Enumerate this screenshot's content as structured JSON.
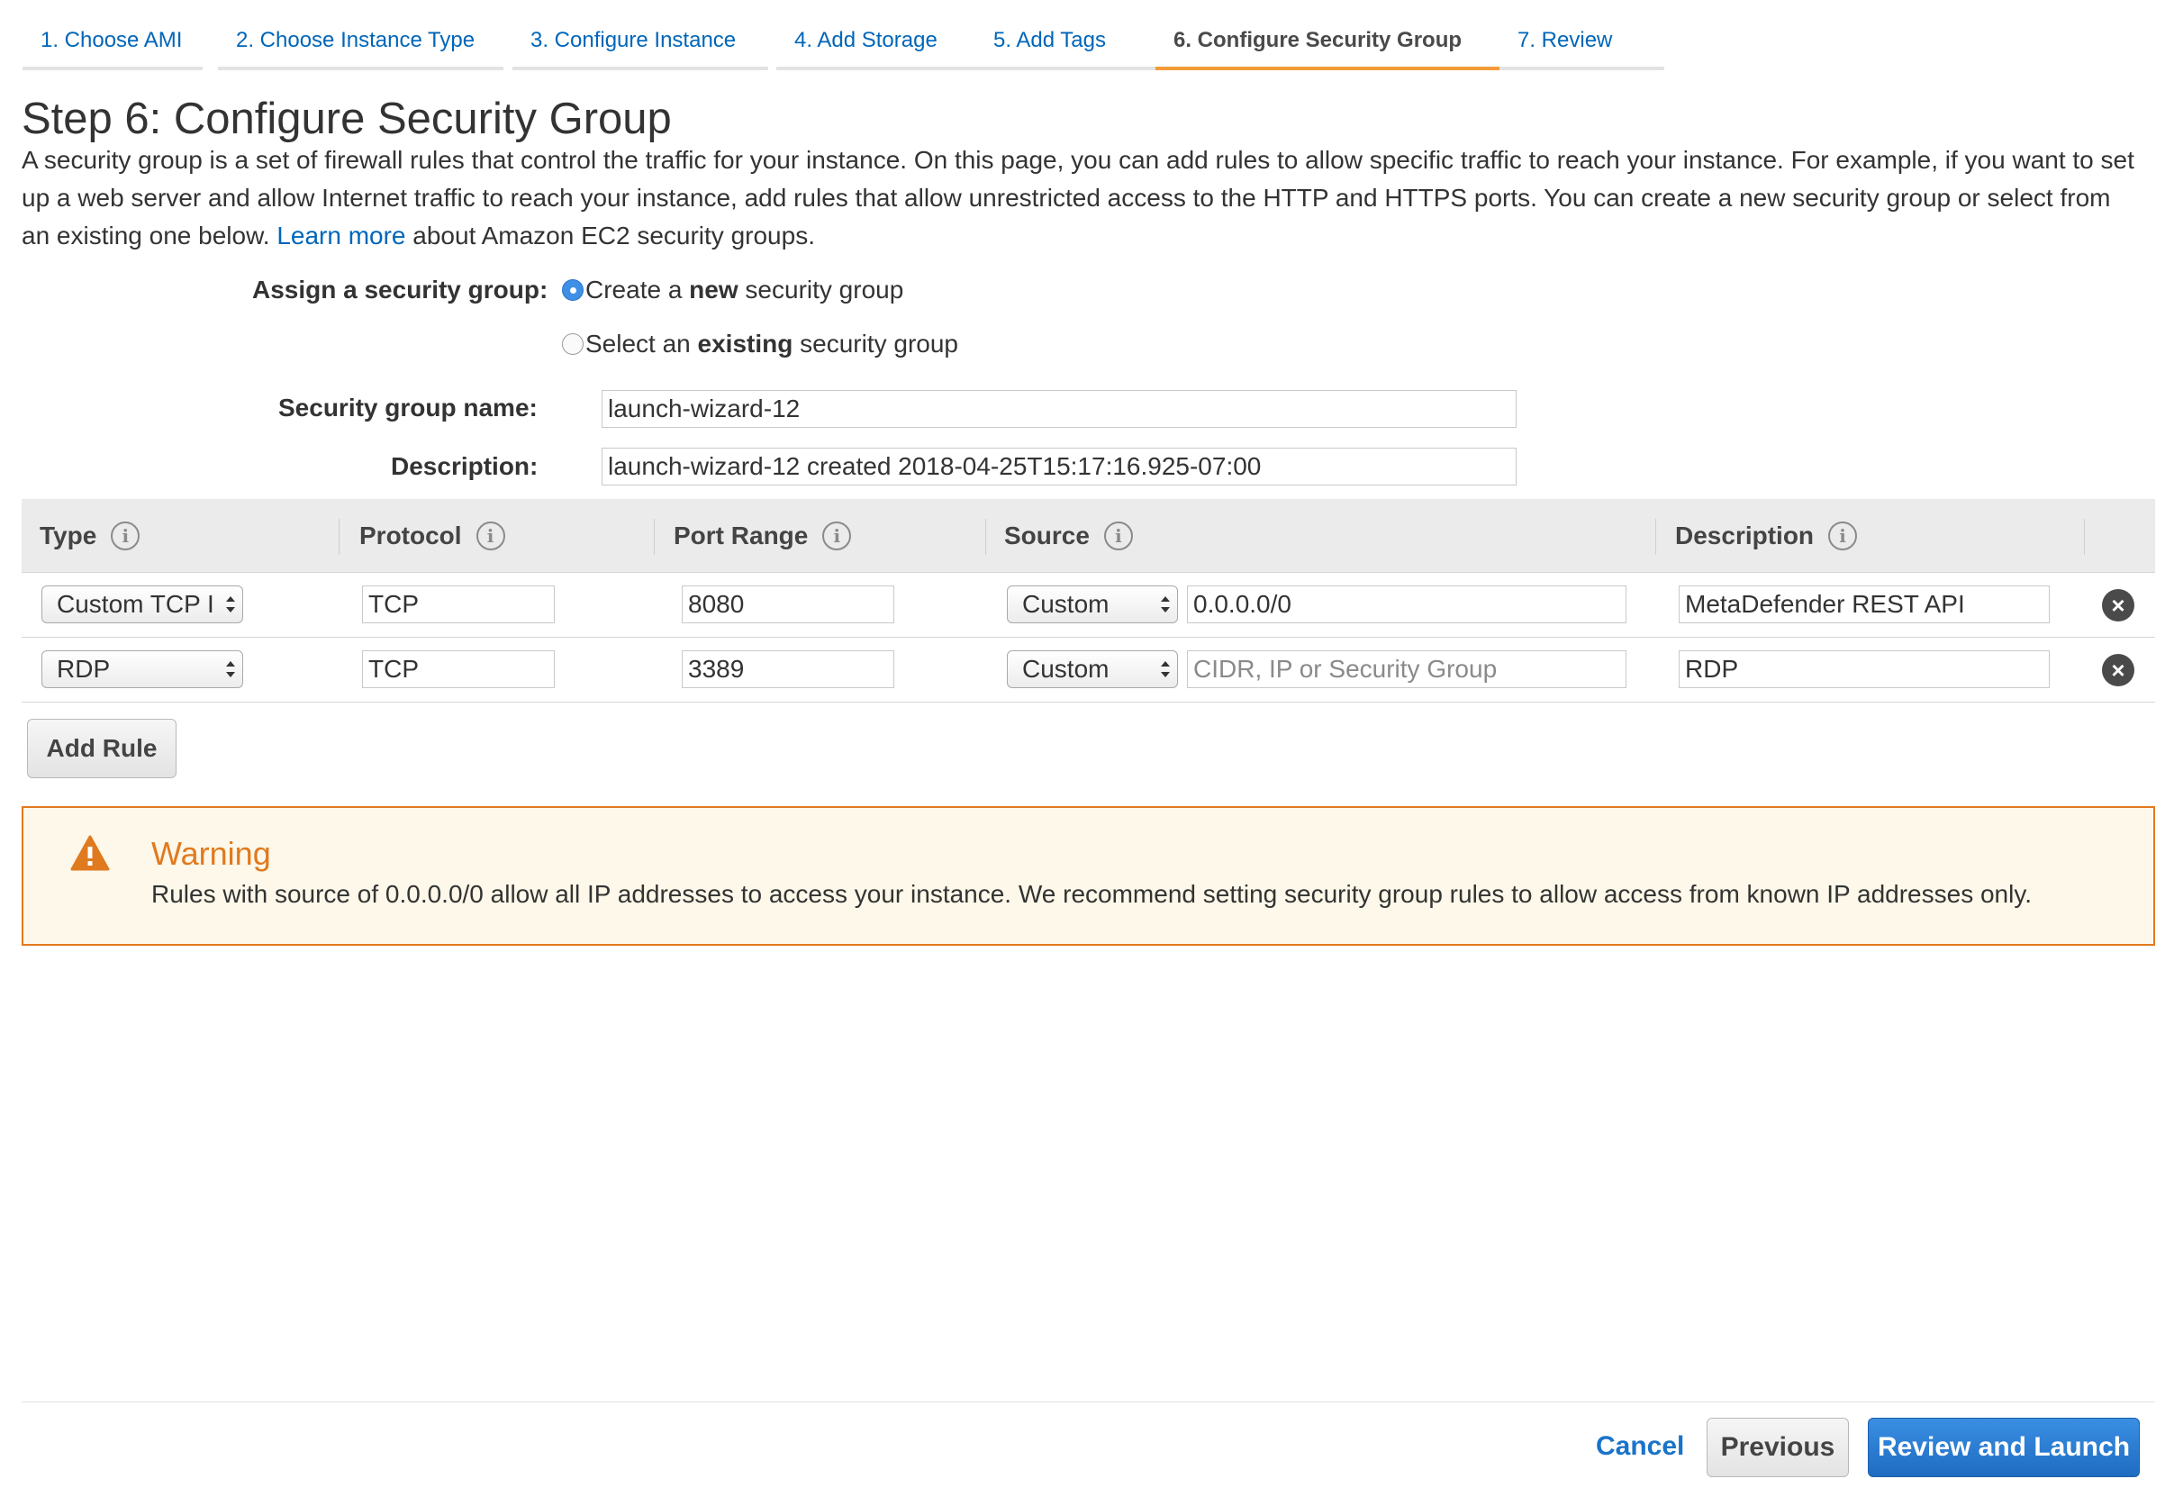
{
  "tabs": [
    {
      "label": "1. Choose AMI"
    },
    {
      "label": "2. Choose Instance Type"
    },
    {
      "label": "3. Configure Instance"
    },
    {
      "label": "4. Add Storage"
    },
    {
      "label": "5. Add Tags"
    },
    {
      "label": "6. Configure Security Group",
      "active": true
    },
    {
      "label": "7. Review"
    }
  ],
  "page": {
    "title": "Step 6: Configure Security Group",
    "intro_before_link": "A security group is a set of firewall rules that control the traffic for your instance. On this page, you can add rules to allow specific traffic to reach your instance. For example, if you want to set up a web server and allow Internet traffic to reach your instance, add rules that allow unrestricted access to the HTTP and HTTPS ports. You can create a new security group or select from an existing one below.",
    "learn_more": "Learn more",
    "intro_after_link": "about Amazon EC2 security groups."
  },
  "assign": {
    "label": "Assign a security group:",
    "option_new_prefix": "Create a ",
    "option_new_bold": "new",
    "option_new_suffix": " security group",
    "option_existing_prefix": "Select an ",
    "option_existing_bold": "existing",
    "option_existing_suffix": " security group",
    "selected": "new"
  },
  "group_name": {
    "label": "Security group name:",
    "value": "launch-wizard-12"
  },
  "description": {
    "label": "Description:",
    "value": "launch-wizard-12 created 2018-04-25T15:17:16.925-07:00"
  },
  "table": {
    "headers": {
      "type": "Type",
      "protocol": "Protocol",
      "port_range": "Port Range",
      "source": "Source",
      "description": "Description"
    },
    "rows": [
      {
        "type": "Custom TCP I",
        "protocol": "TCP",
        "port_range": "8080",
        "source_mode": "Custom",
        "source_value": "0.0.0.0/0",
        "source_placeholder": "",
        "description": "MetaDefender REST API"
      },
      {
        "type": "RDP",
        "protocol": "TCP",
        "port_range": "3389",
        "source_mode": "Custom",
        "source_value": "",
        "source_placeholder": "CIDR, IP or Security Group",
        "description": "RDP"
      }
    ]
  },
  "add_rule_label": "Add Rule",
  "warning": {
    "title": "Warning",
    "text": "Rules with source of 0.0.0.0/0 allow all IP addresses to access your instance. We recommend setting security group rules to allow access from known IP addresses only."
  },
  "footer": {
    "cancel": "Cancel",
    "previous": "Previous",
    "review_launch": "Review and Launch"
  },
  "colors": {
    "accent": "#0066b8",
    "active_tab": "#f39b3a",
    "warning": "#e07a1f",
    "primary_button": "#1e6cc2"
  },
  "icons": {
    "info": "info-icon",
    "remove": "close-circle-icon",
    "warning": "warning-triangle-icon",
    "select_arrows": "select-arrows-icon"
  }
}
